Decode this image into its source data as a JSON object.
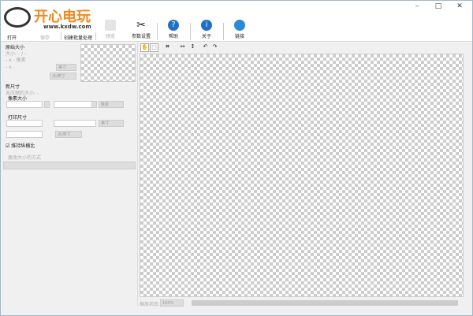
{
  "logo": {
    "title": "开心电玩",
    "url": "www.kxdw.com"
  },
  "window": {
    "minimize": "–",
    "maximize": "□",
    "close": "✕"
  },
  "toolbar": {
    "open": "打开",
    "save": "保存",
    "batch": "创建批量处理",
    "preview": "预览",
    "settings": "参数设置",
    "help": "帮助",
    "about": "关于",
    "link": "链接"
  },
  "left": {
    "original_title": "原始大小",
    "size": "大小: - / -",
    "pixels": "- x - 像素",
    "dims": "- x -",
    "unit_inch": "英寸",
    "unit_dpi": "点/英寸",
    "new_title": "新尺寸",
    "uncompressed": "未压缩的大小: -",
    "pixel_size": "像素大小",
    "unit_pixel": "像素",
    "print_size": "打印尺寸",
    "keep_ratio": "维持纵横比",
    "resize_method": "更改大小的方式",
    "x": "x"
  },
  "status": {
    "zoom_label": "缩放状态:",
    "zoom_value": "100%"
  }
}
